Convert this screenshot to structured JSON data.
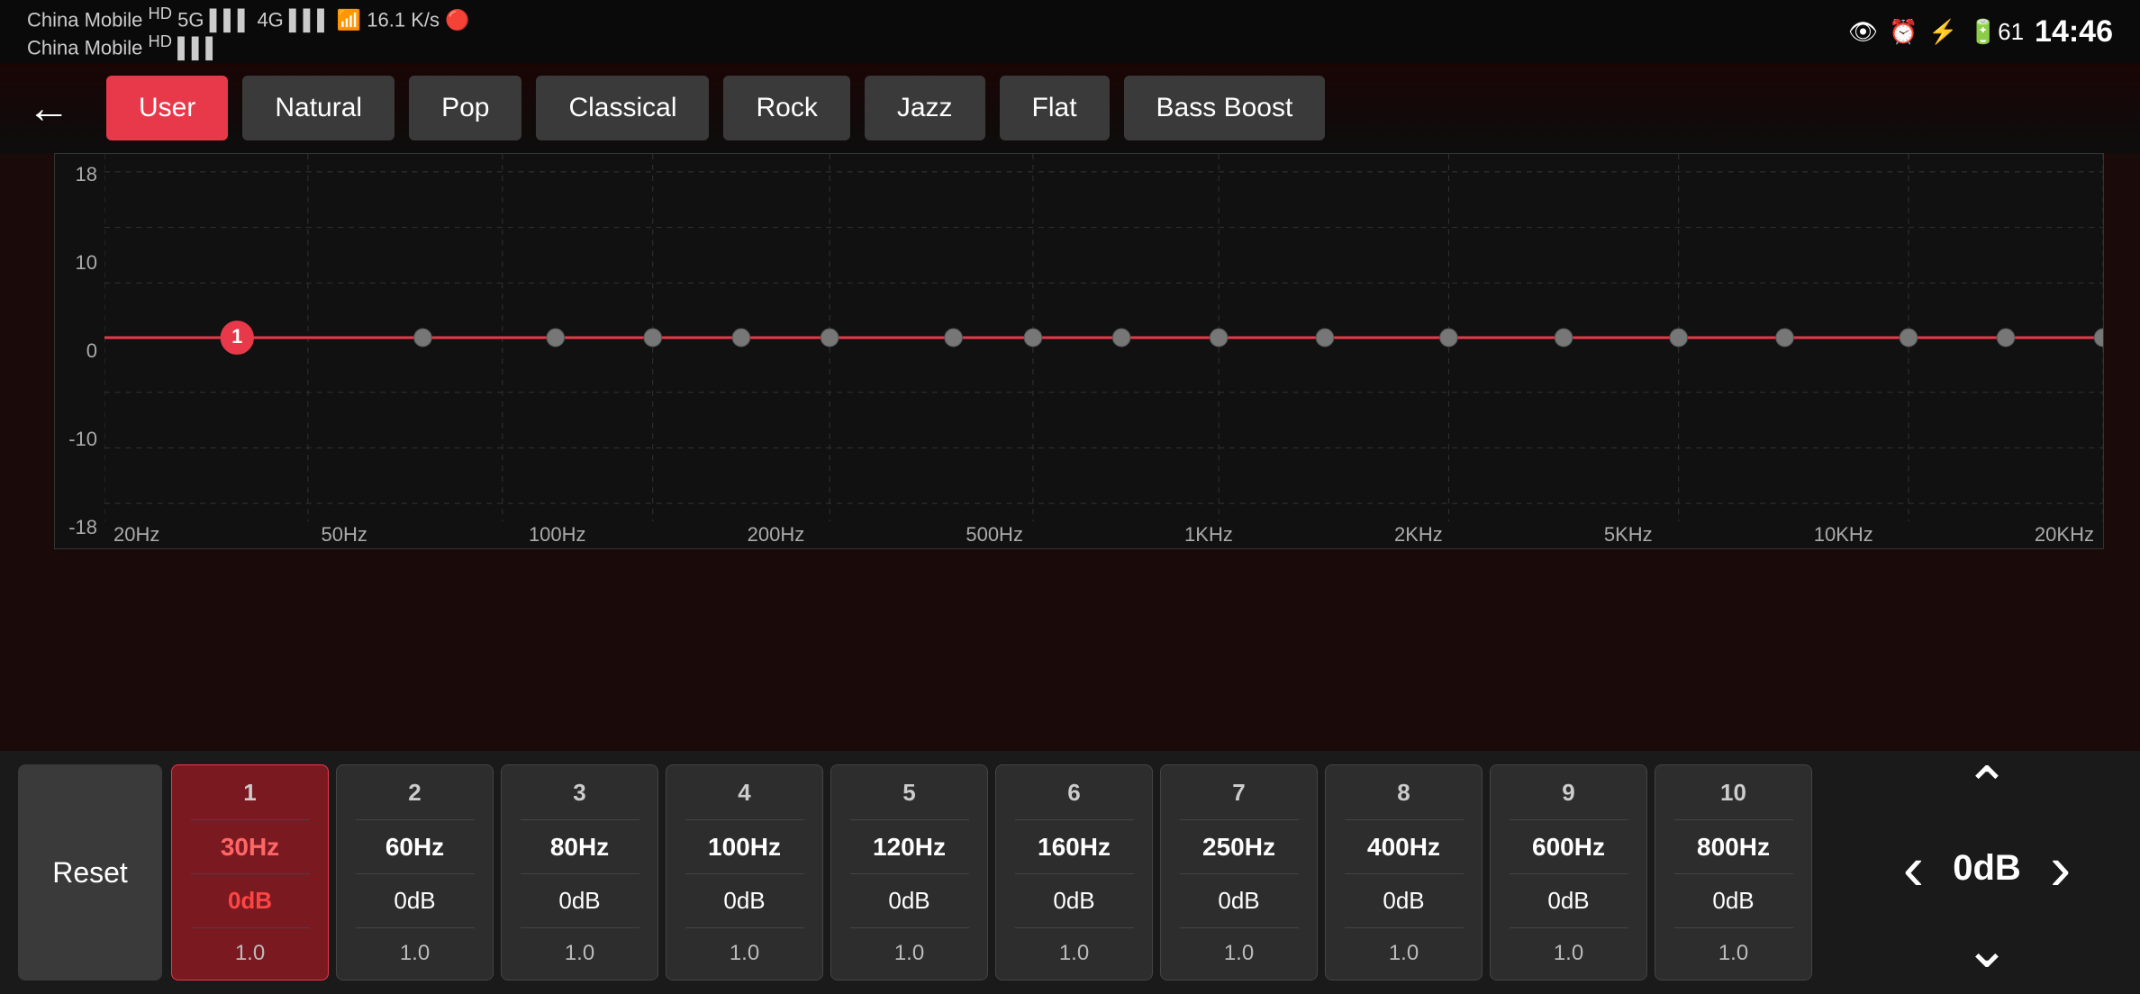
{
  "status": {
    "carrier": "China Mobile",
    "carrier_badge": "HD",
    "network": "5G",
    "signal_left": "●●●",
    "carrier2": "China Mobile",
    "carrier2_badge": "HD",
    "signal_right": "●●●",
    "wifi_speed": "16.1 K/s",
    "time": "14:46",
    "battery": "61"
  },
  "header": {
    "back_label": "←",
    "presets": [
      {
        "id": "user",
        "label": "User",
        "active": true
      },
      {
        "id": "natural",
        "label": "Natural",
        "active": false
      },
      {
        "id": "pop",
        "label": "Pop",
        "active": false
      },
      {
        "id": "classical",
        "label": "Classical",
        "active": false
      },
      {
        "id": "rock",
        "label": "Rock",
        "active": false
      },
      {
        "id": "jazz",
        "label": "Jazz",
        "active": false
      },
      {
        "id": "flat",
        "label": "Flat",
        "active": false
      },
      {
        "id": "bass-boost",
        "label": "Bass Boost",
        "active": false
      }
    ]
  },
  "chart": {
    "y_labels": [
      "18",
      "10",
      "0",
      "-10",
      "-18"
    ],
    "x_labels": [
      "20Hz",
      "50Hz",
      "100Hz",
      "200Hz",
      "500Hz",
      "1KHz",
      "2KHz",
      "5KHz",
      "10KHz",
      "20KHz"
    ],
    "line_color": "#e8394a",
    "grid_color": "#333",
    "dot_color": "#888",
    "active_dot_color": "#e8394a"
  },
  "bands": [
    {
      "number": "1",
      "freq": "30Hz",
      "db": "0dB",
      "q": "1.0",
      "active": true
    },
    {
      "number": "2",
      "freq": "60Hz",
      "db": "0dB",
      "q": "1.0",
      "active": false
    },
    {
      "number": "3",
      "freq": "80Hz",
      "db": "0dB",
      "q": "1.0",
      "active": false
    },
    {
      "number": "4",
      "freq": "100Hz",
      "db": "0dB",
      "q": "1.0",
      "active": false
    },
    {
      "number": "5",
      "freq": "120Hz",
      "db": "0dB",
      "q": "1.0",
      "active": false
    },
    {
      "number": "6",
      "freq": "160Hz",
      "db": "0dB",
      "q": "1.0",
      "active": false
    },
    {
      "number": "7",
      "freq": "250Hz",
      "db": "0dB",
      "q": "1.0",
      "active": false
    },
    {
      "number": "8",
      "freq": "400Hz",
      "db": "0dB",
      "q": "1.0",
      "active": false
    },
    {
      "number": "9",
      "freq": "600Hz",
      "db": "0dB",
      "q": "1.0",
      "active": false
    },
    {
      "number": "10",
      "freq": "800Hz",
      "db": "0dB",
      "q": "1.0",
      "active": false
    }
  ],
  "controls": {
    "reset_label": "Reset",
    "current_value": "0dB",
    "up_arrow": "⌃",
    "down_arrow": "⌄",
    "left_arrow": "‹",
    "right_arrow": "›"
  }
}
